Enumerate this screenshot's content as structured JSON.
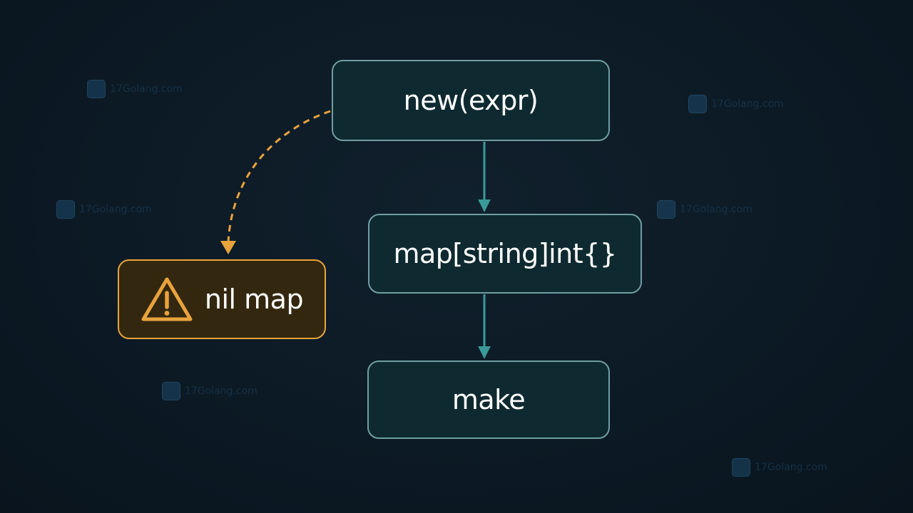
{
  "nodes": {
    "new_expr": "new(expr)",
    "map_literal": "map[string]int{}",
    "make": "make",
    "nil_map": "nil map"
  },
  "icons": {
    "warning": "warning-triangle-icon"
  },
  "watermark": {
    "text": "17Golang.com"
  },
  "colors": {
    "background": "#0c1a25",
    "node_fill": "#0e2a30",
    "node_border": "#6f9ea3",
    "arrow": "#3a9a98",
    "warn_fill": "#33280f",
    "warn_accent": "#e8a33c"
  }
}
